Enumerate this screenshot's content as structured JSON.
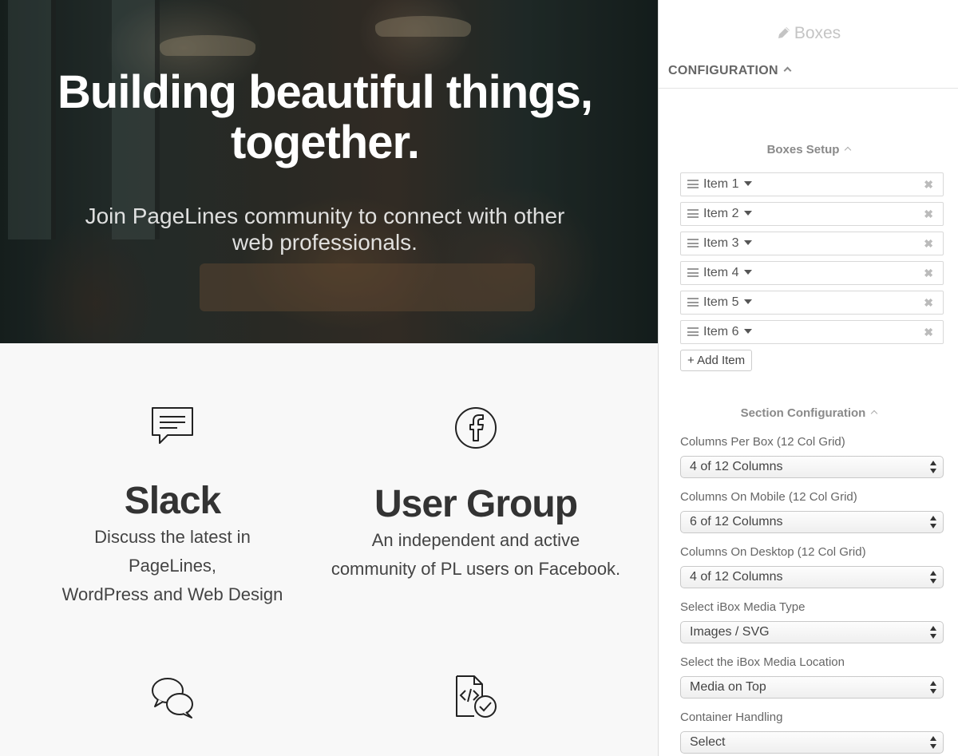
{
  "hero": {
    "title_line1": "Building beautiful things,",
    "title_line2": "together.",
    "subtitle_line1": "Join PageLines community to connect with other",
    "subtitle_line2": "web professionals."
  },
  "boxes": [
    {
      "icon": "chat-bubble-icon",
      "title": "Slack",
      "desc_line1": "Discuss the latest in PageLines,",
      "desc_line2": "WordPress and Web Design"
    },
    {
      "icon": "facebook-icon",
      "title": "User Group",
      "desc_line1": "An independent and active",
      "desc_line2": "community of PL users on Facebook."
    },
    {
      "icon": "chat-bubbles-icon",
      "title": "",
      "desc_line1": "",
      "desc_line2": ""
    },
    {
      "icon": "code-document-check-icon",
      "title": "",
      "desc_line1": "",
      "desc_line2": ""
    }
  ],
  "panel": {
    "title": "Boxes",
    "title_icon": "pencil-icon",
    "config_header": "CONFIGURATION",
    "boxes_setup_heading": "Boxes Setup",
    "items": [
      {
        "label": "Item 1"
      },
      {
        "label": "Item 2"
      },
      {
        "label": "Item 3"
      },
      {
        "label": "Item 4"
      },
      {
        "label": "Item 5"
      },
      {
        "label": "Item 6"
      }
    ],
    "remove_glyph": "✖",
    "add_item_label": "+ Add Item",
    "section_config_heading": "Section Configuration",
    "fields": [
      {
        "label": "Columns Per Box (12 Col Grid)",
        "value": "4 of 12 Columns"
      },
      {
        "label": "Columns On Mobile (12 Col Grid)",
        "value": "6 of 12 Columns"
      },
      {
        "label": "Columns On Desktop (12 Col Grid)",
        "value": "4 of 12 Columns"
      },
      {
        "label": "Select iBox Media Type",
        "value": "Images / SVG"
      },
      {
        "label": "Select the iBox Media Location",
        "value": "Media on Top"
      },
      {
        "label": "Container Handling",
        "value": "Select"
      }
    ]
  },
  "colors": {
    "panel_title": "#c4c4c4",
    "heading_gray": "#8a8a8a",
    "text_dark": "#333333",
    "hero_text": "#ffffff"
  }
}
